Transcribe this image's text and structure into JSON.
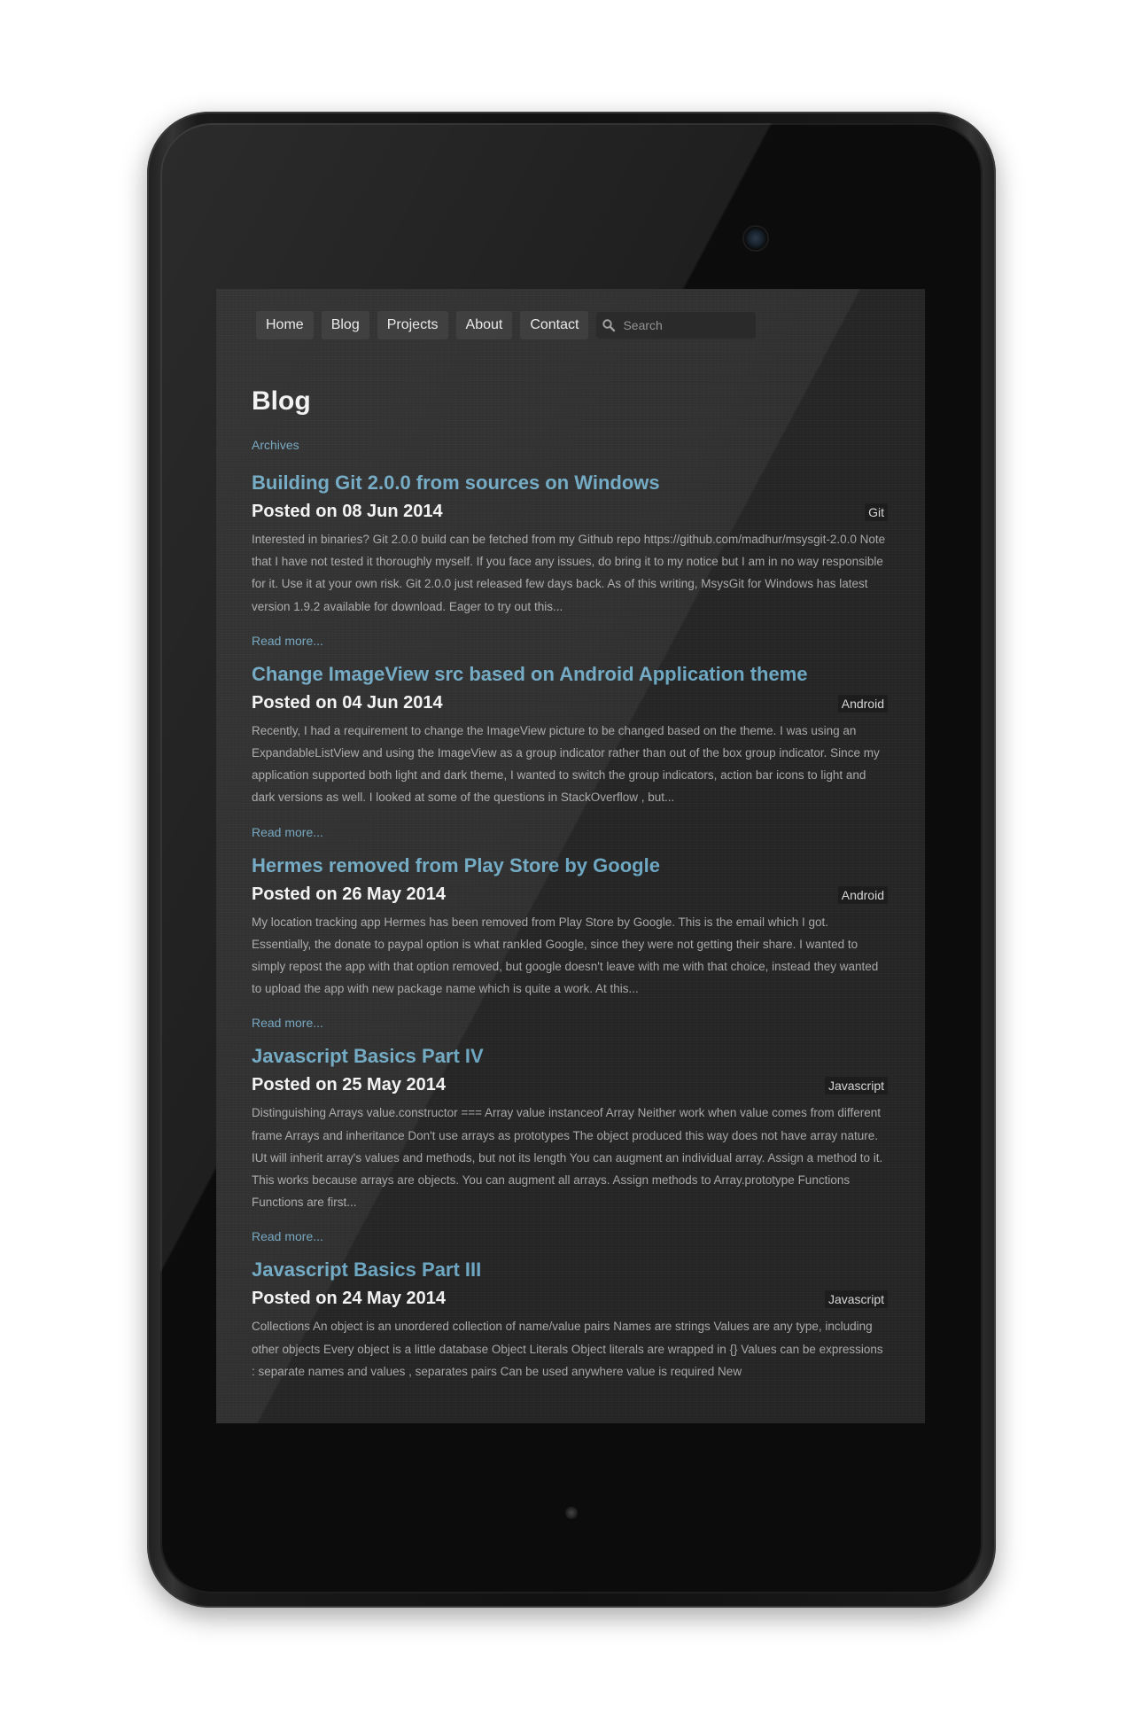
{
  "nav": {
    "items": [
      {
        "label": "Home"
      },
      {
        "label": "Blog"
      },
      {
        "label": "Projects"
      },
      {
        "label": "About"
      },
      {
        "label": "Contact"
      }
    ],
    "search_placeholder": "Search"
  },
  "page": {
    "title": "Blog",
    "archives_link": "Archives"
  },
  "posts": [
    {
      "title": "Building Git 2.0.0 from sources on Windows",
      "date": "Posted on 08 Jun 2014",
      "tag": "Git",
      "excerpt": "Interested in binaries? Git 2.0.0 build can be fetched from my Github repo https://github.com/madhur/msysgit-2.0.0 Note that I have not tested it thoroughly myself. If you face any issues, do bring it to my notice but I am in no way responsible for it. Use it at your own risk. Git 2.0.0 just released few days back. As of this writing, MsysGit for Windows has latest version 1.9.2 available for download. Eager to try out this...",
      "read_more": "Read more..."
    },
    {
      "title": "Change ImageView src based on Android Application theme",
      "date": "Posted on 04 Jun 2014",
      "tag": "Android",
      "excerpt": "Recently, I had a requirement to change the ImageView picture to be changed based on the theme. I was using an ExpandableListView and using the ImageView as a group indicator rather than out of the box group indicator. Since my application supported both light and dark theme, I wanted to switch the group indicators, action bar icons to light and dark versions as well. I looked at some of the questions in StackOverflow , but...",
      "read_more": "Read more..."
    },
    {
      "title": "Hermes removed from Play Store by Google",
      "date": "Posted on 26 May 2014",
      "tag": "Android",
      "excerpt": "My location tracking app Hermes has been removed from Play Store by Google. This is the email which I got. Essentially, the donate to paypal option is what rankled Google, since they were not getting their share. I wanted to simply repost the app with that option removed, but google doesn't leave with me with that choice, instead they wanted to upload the app with new package name which is quite a work. At this...",
      "read_more": "Read more..."
    },
    {
      "title": "Javascript Basics Part IV",
      "date": "Posted on 25 May 2014",
      "tag": "Javascript",
      "excerpt": "Distinguishing Arrays value.constructor === Array value instanceof Array Neither work when value comes from different frame Arrays and inheritance Don't use arrays as prototypes The object produced this way does not have array nature. IUt will inherit array's values and methods, but not its length You can augment an individual array. Assign a method to it. This works because arrays are objects. You can augment all arrays. Assign methods to Array.prototype Functions Functions are first...",
      "read_more": "Read more..."
    },
    {
      "title": "Javascript Basics Part III",
      "date": "Posted on 24 May 2014",
      "tag": "Javascript",
      "excerpt": "Collections An object is an unordered collection of name/value pairs Names are strings Values are any type, including other objects Every object is a little database Object Literals Object literals are wrapped in {} Values can be expressions : separate names and values , separates pairs Can be used anywhere value is required New",
      "read_more": ""
    }
  ]
}
